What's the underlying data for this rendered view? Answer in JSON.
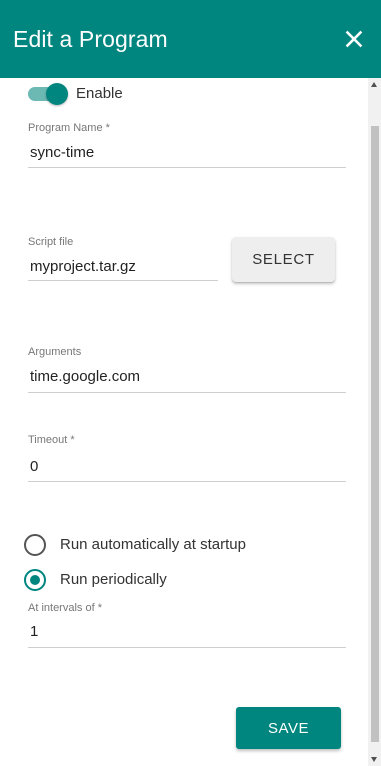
{
  "dialog": {
    "title": "Edit a Program",
    "close_icon": "close-icon",
    "header_color": "#00857f"
  },
  "enable": {
    "label": "Enable",
    "checked": true
  },
  "program_name": {
    "label": "Program Name *",
    "value": "sync-time"
  },
  "script_file": {
    "label": "Script file",
    "value": "myproject.tar.gz",
    "select_label": "SELECT"
  },
  "arguments": {
    "label": "Arguments",
    "value": "time.google.com"
  },
  "timeout": {
    "label": "Timeout *",
    "value": "0"
  },
  "run_mode": {
    "options": [
      {
        "label": "Run automatically at startup",
        "checked": false
      },
      {
        "label": "Run periodically",
        "checked": true
      }
    ]
  },
  "interval": {
    "label": "At intervals of *",
    "value": "1"
  },
  "actions": {
    "save_label": "SAVE"
  }
}
